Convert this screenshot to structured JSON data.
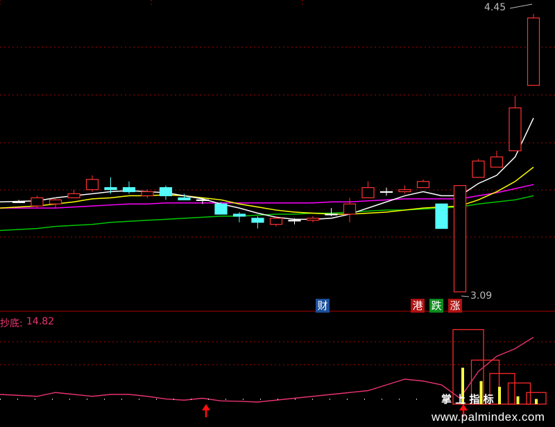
{
  "main_chart": {
    "price_high_label": "4.45",
    "price_low_label": "3.09",
    "event_badges": [
      {
        "text": "财",
        "color": "#1a4f9a"
      },
      {
        "text": "港",
        "color": "#b01010"
      },
      {
        "text": "跌",
        "color": "#0c8a1c"
      },
      {
        "text": "涨",
        "color": "#b01010"
      }
    ]
  },
  "indicator": {
    "label": "抄底:",
    "value": "14.82",
    "caption": "掌 上 指 标"
  },
  "watermark": "www.palmindex.com",
  "colors": {
    "background": "#000000",
    "up_candle": "#ff3232",
    "down_candle": "#54fcfc",
    "ma_short": "#ffffff",
    "ma_mid": "#ffff00",
    "ma_long": "#ff00ff",
    "ma_xlong": "#00c800",
    "indicator_line": "#e8336f",
    "grid": "#b00000"
  },
  "chart_data": {
    "type": "candlestick",
    "title": "",
    "ylim": [
      3.09,
      4.45
    ],
    "candles": [
      {
        "o": 3.53,
        "h": 3.54,
        "l": 3.53,
        "c": 3.53
      },
      {
        "o": 3.51,
        "h": 3.56,
        "l": 3.5,
        "c": 3.55
      },
      {
        "o": 3.52,
        "h": 3.55,
        "l": 3.5,
        "c": 3.54
      },
      {
        "o": 3.55,
        "h": 3.59,
        "l": 3.55,
        "c": 3.57
      },
      {
        "o": 3.59,
        "h": 3.66,
        "l": 3.58,
        "c": 3.64
      },
      {
        "o": 3.6,
        "h": 3.65,
        "l": 3.57,
        "c": 3.59
      },
      {
        "o": 3.6,
        "h": 3.63,
        "l": 3.57,
        "c": 3.58
      },
      {
        "o": 3.56,
        "h": 3.59,
        "l": 3.55,
        "c": 3.58
      },
      {
        "o": 3.6,
        "h": 3.61,
        "l": 3.54,
        "c": 3.56
      },
      {
        "o": 3.55,
        "h": 3.57,
        "l": 3.54,
        "c": 3.54
      },
      {
        "o": 3.54,
        "h": 3.55,
        "l": 3.52,
        "c": 3.54
      },
      {
        "o": 3.52,
        "h": 3.53,
        "l": 3.48,
        "c": 3.47
      },
      {
        "o": 3.47,
        "h": 3.48,
        "l": 3.43,
        "c": 3.46
      },
      {
        "o": 3.45,
        "h": 3.46,
        "l": 3.4,
        "c": 3.43
      },
      {
        "o": 3.42,
        "h": 3.46,
        "l": 3.41,
        "c": 3.45
      },
      {
        "o": 3.44,
        "h": 3.45,
        "l": 3.42,
        "c": 3.44
      },
      {
        "o": 3.44,
        "h": 3.46,
        "l": 3.43,
        "c": 3.45
      },
      {
        "o": 3.47,
        "h": 3.5,
        "l": 3.46,
        "c": 3.47
      },
      {
        "o": 3.47,
        "h": 3.55,
        "l": 3.43,
        "c": 3.52
      },
      {
        "o": 3.55,
        "h": 3.63,
        "l": 3.55,
        "c": 3.6
      },
      {
        "o": 3.58,
        "h": 3.6,
        "l": 3.56,
        "c": 3.58
      },
      {
        "o": 3.58,
        "h": 3.61,
        "l": 3.57,
        "c": 3.59
      },
      {
        "o": 3.6,
        "h": 3.64,
        "l": 3.6,
        "c": 3.63
      },
      {
        "o": 3.52,
        "h": 3.52,
        "l": 3.4,
        "c": 3.4
      },
      {
        "o": 3.09,
        "h": 3.61,
        "l": 3.09,
        "c": 3.61
      },
      {
        "o": 3.65,
        "h": 3.74,
        "l": 3.65,
        "c": 3.73
      },
      {
        "o": 3.7,
        "h": 3.78,
        "l": 3.7,
        "c": 3.75
      },
      {
        "o": 3.78,
        "h": 4.05,
        "l": 3.78,
        "c": 3.99
      },
      {
        "o": 4.1,
        "h": 4.45,
        "l": 4.1,
        "c": 4.43
      }
    ],
    "ma_short": [
      3.53,
      3.535,
      3.55,
      3.56,
      3.57,
      3.58,
      3.585,
      3.58,
      3.575,
      3.56,
      3.545,
      3.52,
      3.5,
      3.475,
      3.455,
      3.445,
      3.445,
      3.45,
      3.47,
      3.5,
      3.53,
      3.56,
      3.58,
      3.56,
      3.56,
      3.62,
      3.66,
      3.75,
      3.94
    ],
    "ma_mid": [
      3.5,
      3.51,
      3.52,
      3.53,
      3.545,
      3.55,
      3.56,
      3.56,
      3.565,
      3.56,
      3.55,
      3.54,
      3.52,
      3.505,
      3.49,
      3.48,
      3.475,
      3.47,
      3.47,
      3.475,
      3.48,
      3.49,
      3.5,
      3.505,
      3.51,
      3.54,
      3.58,
      3.63,
      3.7
    ],
    "ma_long": [
      3.5,
      3.5,
      3.5,
      3.505,
      3.51,
      3.515,
      3.52,
      3.52,
      3.525,
      3.525,
      3.525,
      3.525,
      3.525,
      3.525,
      3.525,
      3.525,
      3.525,
      3.53,
      3.53,
      3.535,
      3.54,
      3.545,
      3.545,
      3.545,
      3.545,
      3.56,
      3.575,
      3.595,
      3.615
    ],
    "ma_xlong": [
      3.39,
      3.4,
      3.41,
      3.415,
      3.42,
      3.43,
      3.435,
      3.44,
      3.445,
      3.45,
      3.455,
      3.46,
      3.46,
      3.465,
      3.47,
      3.47,
      3.475,
      3.475,
      3.48,
      3.485,
      3.49,
      3.49,
      3.495,
      3.5,
      3.505,
      3.52,
      3.53,
      3.54,
      3.56
    ],
    "indicator_line": [
      2.0,
      1.5,
      2.5,
      2.0,
      1.5,
      2.0,
      2.0,
      1.5,
      0.8,
      0.5,
      1.0,
      0.3,
      0.2,
      0.0,
      0.5,
      1.0,
      1.5,
      2.0,
      2.5,
      3.0,
      4.5,
      6.0,
      5.5,
      4.5,
      1.0,
      8.0,
      12.0,
      14.0,
      17.0
    ],
    "indicator_bars": [
      0,
      0,
      0,
      0,
      0,
      0,
      0,
      0,
      0,
      0,
      0,
      0,
      0,
      0,
      0,
      0,
      0,
      0,
      0,
      0,
      0,
      0,
      0,
      0,
      19.0,
      11.0,
      7.5,
      5.0,
      2.5
    ],
    "indicator_yellow_bars": [
      0,
      0,
      0,
      0,
      0,
      0,
      0,
      0,
      0,
      0,
      0,
      0,
      0,
      0,
      0,
      0,
      0,
      0,
      0,
      0,
      0,
      0,
      0,
      0,
      9.0,
      5.5,
      4.0,
      1.5,
      0.8
    ],
    "buy_arrows": [
      10,
      24
    ]
  }
}
